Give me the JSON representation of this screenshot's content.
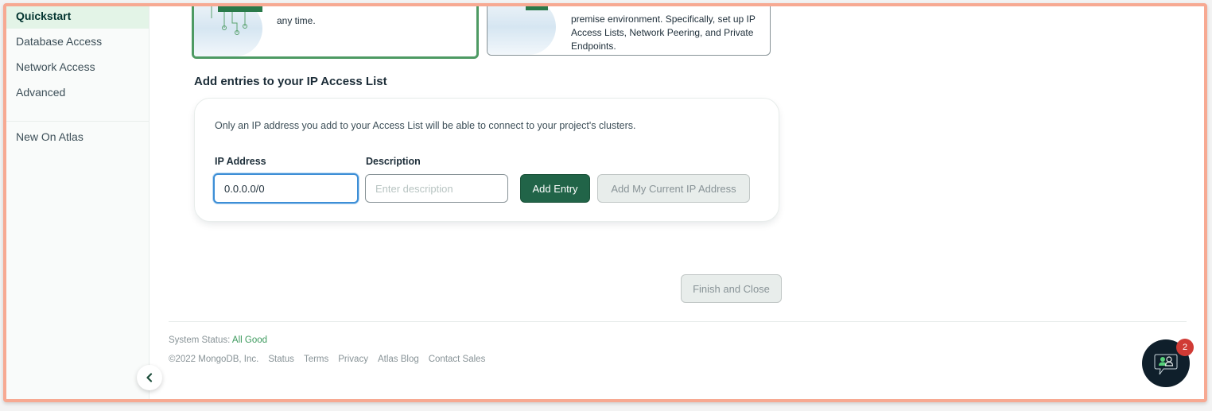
{
  "sidebar": {
    "items": [
      {
        "label": "Quickstart",
        "active": true
      },
      {
        "label": "Database Access",
        "active": false
      },
      {
        "label": "Network Access",
        "active": false
      },
      {
        "label": "Advanced",
        "active": false
      }
    ],
    "secondary_items": [
      {
        "label": "New On Atlas"
      }
    ],
    "collapse_icon": "chevron-left-icon"
  },
  "cards": {
    "local": {
      "text": "any time.",
      "selected": true
    },
    "cloud": {
      "text": "premise environment. Specifically, set up IP Access Lists, Network Peering, and Private Endpoints.",
      "selected": false
    }
  },
  "access_list": {
    "title": "Add entries to your IP Access List",
    "description": "Only an IP address you add to your Access List will be able to connect to your project's clusters.",
    "ip_label": "IP Address",
    "ip_value": "0.0.0.0/0",
    "description_label": "Description",
    "description_placeholder": "Enter description",
    "description_value": "",
    "add_entry_label": "Add Entry",
    "add_current_ip_label": "Add My Current IP Address"
  },
  "finish_label": "Finish and Close",
  "footer": {
    "status_label": "System Status:",
    "status_value": "All Good",
    "copyright": "©2022 MongoDB, Inc.",
    "links": [
      "Status",
      "Terms",
      "Privacy",
      "Atlas Blog",
      "Contact Sales"
    ]
  },
  "chat": {
    "icon": "chat-support-icon",
    "badge_count": "2"
  },
  "colors": {
    "accent_green": "#216448",
    "selected_border": "#4d9a63",
    "focus_blue": "#3d8ed6",
    "status_good": "#3d9a5e",
    "badge_red": "#d03b35",
    "frame_border": "#f7a992"
  }
}
